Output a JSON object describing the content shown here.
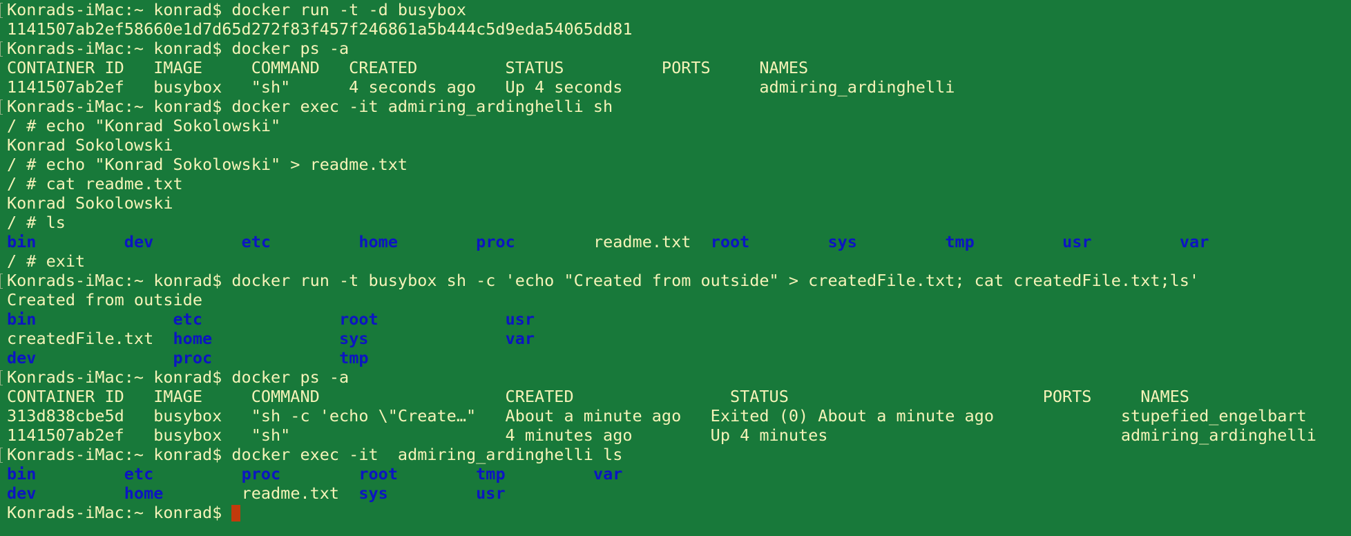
{
  "colors": {
    "background": "#18793a",
    "text": "#f5f3b8",
    "directory": "#0c15c2",
    "cursor": "#c23a0c"
  },
  "terminal": {
    "lines": [
      {
        "kind": "prompt",
        "text": "Konrads-iMac:~ konrad$ docker run -t -d busybox"
      },
      {
        "kind": "output",
        "text": "1141507ab2ef58660e1d7d65d272f83f457f246861a5b444c5d9eda54065dd81"
      },
      {
        "kind": "prompt",
        "text": "Konrads-iMac:~ konrad$ docker ps -a"
      },
      {
        "kind": "output",
        "text": "CONTAINER ID   IMAGE     COMMAND   CREATED         STATUS          PORTS     NAMES"
      },
      {
        "kind": "output",
        "text": "1141507ab2ef   busybox   \"sh\"      4 seconds ago   Up 4 seconds              admiring_ardinghelli"
      },
      {
        "kind": "prompt",
        "text": "Konrads-iMac:~ konrad$ docker exec -it admiring_ardinghelli sh"
      },
      {
        "kind": "prompt",
        "text": "/ # echo \"Konrad Sokolowski\""
      },
      {
        "kind": "output",
        "text": "Konrad Sokolowski"
      },
      {
        "kind": "prompt",
        "text": "/ # echo \"Konrad Sokolowski\" > readme.txt"
      },
      {
        "kind": "prompt",
        "text": "/ # cat readme.txt"
      },
      {
        "kind": "output",
        "text": "Konrad Sokolowski"
      },
      {
        "kind": "prompt",
        "text": "/ # ls"
      },
      {
        "kind": "listing",
        "segments": [
          {
            "t": "bin",
            "dir": true
          },
          {
            "t": "         ",
            "dir": false
          },
          {
            "t": "dev",
            "dir": true
          },
          {
            "t": "         ",
            "dir": false
          },
          {
            "t": "etc",
            "dir": true
          },
          {
            "t": "         ",
            "dir": false
          },
          {
            "t": "home",
            "dir": true
          },
          {
            "t": "        ",
            "dir": false
          },
          {
            "t": "proc",
            "dir": true
          },
          {
            "t": "        ",
            "dir": false
          },
          {
            "t": "readme.txt",
            "dir": false
          },
          {
            "t": "  ",
            "dir": false
          },
          {
            "t": "root",
            "dir": true
          },
          {
            "t": "        ",
            "dir": false
          },
          {
            "t": "sys",
            "dir": true
          },
          {
            "t": "         ",
            "dir": false
          },
          {
            "t": "tmp",
            "dir": true
          },
          {
            "t": "         ",
            "dir": false
          },
          {
            "t": "usr",
            "dir": true
          },
          {
            "t": "         ",
            "dir": false
          },
          {
            "t": "var",
            "dir": true
          }
        ]
      },
      {
        "kind": "prompt",
        "text": "/ # exit"
      },
      {
        "kind": "prompt",
        "text": "Konrads-iMac:~ konrad$ docker run -t busybox sh -c 'echo \"Created from outside\" > createdFile.txt; cat createdFile.txt;ls'"
      },
      {
        "kind": "output",
        "text": "Created from outside"
      },
      {
        "kind": "listing",
        "segments": [
          {
            "t": "bin",
            "dir": true
          },
          {
            "t": "              ",
            "dir": false
          },
          {
            "t": "etc",
            "dir": true
          },
          {
            "t": "              ",
            "dir": false
          },
          {
            "t": "root",
            "dir": true
          },
          {
            "t": "             ",
            "dir": false
          },
          {
            "t": "usr",
            "dir": true
          }
        ]
      },
      {
        "kind": "listing",
        "segments": [
          {
            "t": "createdFile.txt",
            "dir": false
          },
          {
            "t": "  ",
            "dir": false
          },
          {
            "t": "home",
            "dir": true
          },
          {
            "t": "             ",
            "dir": false
          },
          {
            "t": "sys",
            "dir": true
          },
          {
            "t": "              ",
            "dir": false
          },
          {
            "t": "var",
            "dir": true
          }
        ]
      },
      {
        "kind": "listing",
        "segments": [
          {
            "t": "dev",
            "dir": true
          },
          {
            "t": "              ",
            "dir": false
          },
          {
            "t": "proc",
            "dir": true
          },
          {
            "t": "             ",
            "dir": false
          },
          {
            "t": "tmp",
            "dir": true
          }
        ]
      },
      {
        "kind": "prompt",
        "text": "Konrads-iMac:~ konrad$ docker ps -a"
      },
      {
        "kind": "output",
        "text": "CONTAINER ID   IMAGE     COMMAND                   CREATED                STATUS                          PORTS     NAMES"
      },
      {
        "kind": "output",
        "text": "313d838cbe5d   busybox   \"sh -c 'echo \\\"Create…\"   About a minute ago   Exited (0) About a minute ago             stupefied_engelbart"
      },
      {
        "kind": "output",
        "text": "1141507ab2ef   busybox   \"sh\"                      4 minutes ago        Up 4 minutes                              admiring_ardinghelli"
      },
      {
        "kind": "prompt",
        "text": "Konrads-iMac:~ konrad$ docker exec -it  admiring_ardinghelli ls"
      },
      {
        "kind": "listing",
        "segments": [
          {
            "t": "bin",
            "dir": true
          },
          {
            "t": "         ",
            "dir": false
          },
          {
            "t": "etc",
            "dir": true
          },
          {
            "t": "         ",
            "dir": false
          },
          {
            "t": "proc",
            "dir": true
          },
          {
            "t": "        ",
            "dir": false
          },
          {
            "t": "root",
            "dir": true
          },
          {
            "t": "        ",
            "dir": false
          },
          {
            "t": "tmp",
            "dir": true
          },
          {
            "t": "         ",
            "dir": false
          },
          {
            "t": "var",
            "dir": true
          }
        ]
      },
      {
        "kind": "listing",
        "segments": [
          {
            "t": "dev",
            "dir": true
          },
          {
            "t": "         ",
            "dir": false
          },
          {
            "t": "home",
            "dir": true
          },
          {
            "t": "        ",
            "dir": false
          },
          {
            "t": "readme.txt",
            "dir": false
          },
          {
            "t": "  ",
            "dir": false
          },
          {
            "t": "sys",
            "dir": true
          },
          {
            "t": "         ",
            "dir": false
          },
          {
            "t": "usr",
            "dir": true
          }
        ]
      },
      {
        "kind": "cursor",
        "text": "Konrads-iMac:~ konrad$ "
      }
    ]
  }
}
